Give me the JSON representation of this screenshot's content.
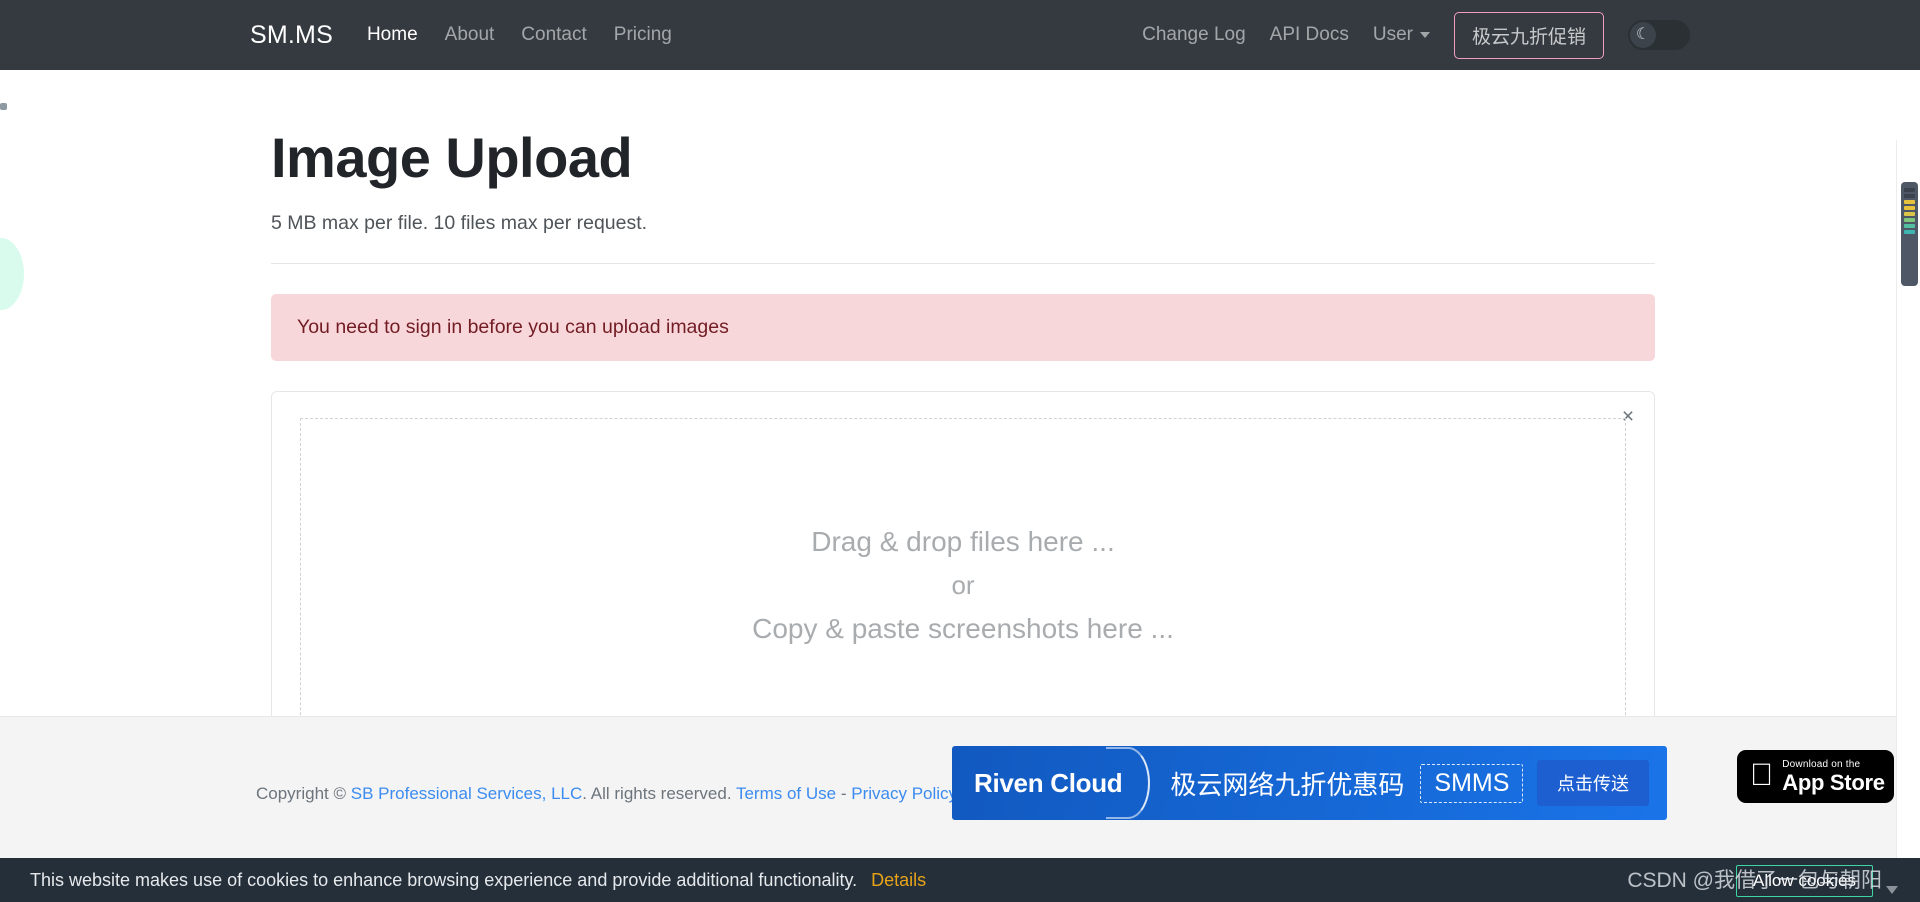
{
  "navbar": {
    "brand": "SM.MS",
    "links": [
      {
        "label": "Home",
        "active": true
      },
      {
        "label": "About",
        "active": false
      },
      {
        "label": "Contact",
        "active": false
      },
      {
        "label": "Pricing",
        "active": false
      }
    ],
    "right_links": [
      {
        "label": "Change Log"
      },
      {
        "label": "API Docs"
      }
    ],
    "user_menu_label": "User",
    "user_caret_icon": "chevron-down-icon",
    "promo_button": "极云九折促销",
    "theme_toggle_icon": "moon-icon",
    "theme_toggle_state": "off",
    "background_color": "#343a40",
    "promo_border_color": "#f09ebc"
  },
  "main": {
    "title": "Image Upload",
    "subtitle": "5 MB max per file. 10 files max per request.",
    "alert": {
      "message": "You need to sign in before you can upload images",
      "background_color": "#f8d7da",
      "text_color": "#721c24"
    },
    "upload_card": {
      "close_icon": "close-icon",
      "close_label": "×",
      "dropzone_line_1": "Drag & drop files here ...",
      "dropzone_line_2": "or",
      "dropzone_line_3": "Copy & paste screenshots here ..."
    }
  },
  "footer": {
    "copyright_prefix": "Copyright",
    "copyright_symbol": "©",
    "company": "SB Professional Services, LLC",
    "rights": ". All rights reserved.",
    "terms_link": "Terms of Use",
    "separator": "-",
    "privacy_link": "Privacy Policy",
    "background_color": "#f4f4f4",
    "link_color": "#3b8bf0"
  },
  "ad": {
    "logo": "Riven Cloud",
    "arc_icon": "crescent-arc-icon",
    "text": "极云网络九折优惠码",
    "code": "SMMS",
    "cta": "点击传送",
    "background_color": "#1668d6"
  },
  "appstore": {
    "apple_icon": "apple-logo-icon",
    "small_text": "Download on the",
    "big_text": "App Store",
    "background_color": "#000000"
  },
  "cookie_bar": {
    "text": "This website makes use of cookies to enhance browsing experience and provide additional functionality.",
    "details_label": "Details",
    "allow_label": "Allow cookies",
    "caret_icon": "chevron-down-icon",
    "background_color": "#252f3a",
    "details_color": "#e8a317",
    "allow_border_color": "#3dd6a4"
  },
  "watermark": {
    "text": "CSDN @我借了一包与朝阳"
  },
  "scrollbar": {
    "thumb_color": "#4e5765",
    "stripe_colors": [
      "#3a424e",
      "#3a424e",
      "#e8c23c",
      "#e8c23c",
      "#dbc64a",
      "#7fc77a",
      "#52bfa0",
      "#3fb5b0"
    ]
  },
  "decor": {
    "bubble_color": "#d9fbee"
  }
}
